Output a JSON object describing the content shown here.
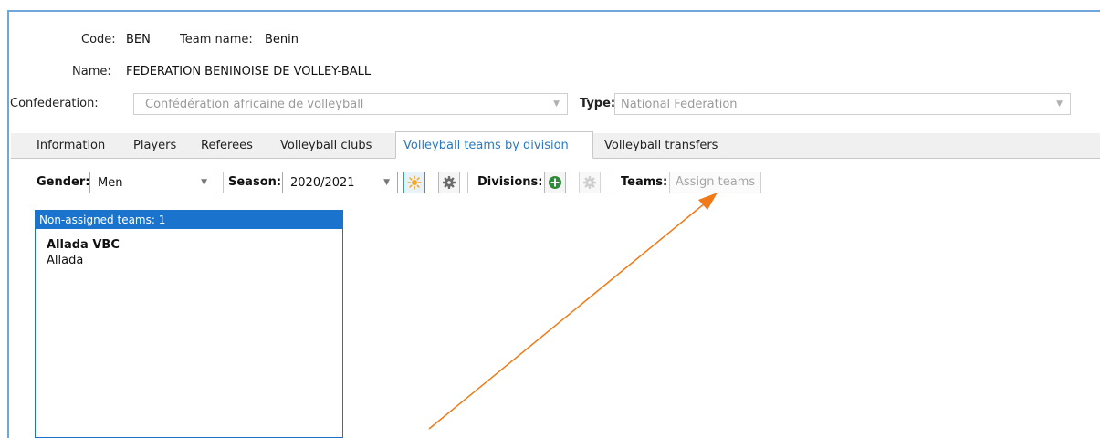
{
  "header": {
    "code_label": "Code:",
    "code_value": "BEN",
    "team_name_label": "Team name:",
    "team_name_value": "Benin",
    "name_label": "Name:",
    "name_value": "FEDERATION BENINOISE DE VOLLEY-BALL",
    "confederation_label": "Confederation:",
    "confederation_value": "Confédération africaine de volleyball",
    "type_label": "Type:",
    "type_value": "National Federation"
  },
  "tabs": [
    {
      "label": "Information"
    },
    {
      "label": "Players"
    },
    {
      "label": "Referees"
    },
    {
      "label": "Volleyball clubs"
    },
    {
      "label": "Volleyball teams by division",
      "selected": true
    },
    {
      "label": "Volleyball transfers"
    }
  ],
  "toolbar": {
    "gender_label": "Gender:",
    "gender_value": "Men",
    "season_label": "Season:",
    "season_value": "2020/2021",
    "divisions_label": "Divisions:",
    "teams_label": "Teams:",
    "assign_teams_label": "Assign teams"
  },
  "non_assigned": {
    "header": "Non-assigned teams: 1",
    "items": [
      {
        "team": "Allada VBC",
        "city": "Allada"
      }
    ]
  },
  "icons": {
    "new_season": "sun-icon",
    "season_settings": "gear-icon",
    "add_division": "plus-circle-icon",
    "division_settings": "gear-icon"
  },
  "colors": {
    "accent_blue": "#1a73cc",
    "tab_selected_text": "#2a79c1",
    "annotation_arrow": "#f07a16",
    "add_green": "#2e8b3a",
    "sun_orange": "#f5a623"
  }
}
